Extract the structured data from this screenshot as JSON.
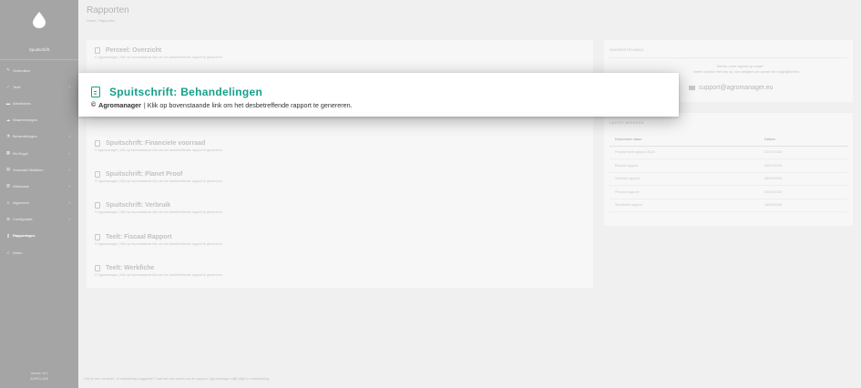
{
  "sidebar": {
    "app_name": "Spuitschrift",
    "items": [
      {
        "icon": "pencil-icon",
        "glyph": "✎",
        "label": "Verbruiken",
        "chevron": false,
        "active": false
      },
      {
        "icon": "chart-icon",
        "glyph": "⁄",
        "label": "Teelt",
        "chevron": true,
        "active": false
      },
      {
        "icon": "truck-icon",
        "glyph": "▬",
        "label": "Werkfiches",
        "chevron": false,
        "active": false
      },
      {
        "icon": "cloud-icon",
        "glyph": "☁",
        "label": "Waarnemingen",
        "chevron": false,
        "active": false
      },
      {
        "icon": "flask-icon",
        "glyph": "⚗",
        "label": "Behandelingen",
        "chevron": true,
        "active": false
      },
      {
        "icon": "box-icon",
        "glyph": "▦",
        "label": "Re-Engel",
        "chevron": true,
        "active": false
      },
      {
        "icon": "calendar-icon",
        "glyph": "▤",
        "label": "Voorraad Middelen",
        "chevron": true,
        "active": false
      },
      {
        "icon": "building-icon",
        "glyph": "▥",
        "label": "Werkbank",
        "chevron": true,
        "active": false
      },
      {
        "icon": "list-icon",
        "glyph": "≡",
        "label": "Algemeen",
        "chevron": true,
        "active": false
      },
      {
        "icon": "gear-icon",
        "glyph": "⚙",
        "label": "Configuratie",
        "chevron": true,
        "active": false
      },
      {
        "icon": "document-icon",
        "glyph": "▯",
        "label": "Rapportages",
        "chevron": false,
        "active": true
      },
      {
        "icon": "share-icon",
        "glyph": "<",
        "label": "Delen",
        "chevron": false,
        "active": false
      }
    ],
    "version_line1": "Versie: 8.0",
    "version_line2": "AGRO-245"
  },
  "header": {
    "title": "Rapporten",
    "breadcrumb_home": "Home",
    "breadcrumb_sep": "/",
    "breadcrumb_current": "Rapporten"
  },
  "reports": [
    {
      "title": "Perceel: Overzicht",
      "subtitle": "© Agromanager | Klik op bovenstaande link om het desbetreffende rapport te genereren."
    },
    {
      "title": "Spuitschrift: Behandelingen",
      "subtitle": "© Agromanager | Klik op bovenstaande link om het desbetreffende rapport te genereren."
    },
    {
      "title": "Spuitschrift: Financiele voorraad",
      "subtitle": "© Agromanager | Klik op bovenstaande link om het desbetreffende rapport te genereren."
    },
    {
      "title": "Spuitschrift: Planet Proof",
      "subtitle": "© Agromanager | Klik op bovenstaande link om het desbetreffende rapport te genereren."
    },
    {
      "title": "Spuitschrift: Verbruik",
      "subtitle": "© Agromanager | Klik op bovenstaande link om het desbetreffende rapport te genereren."
    },
    {
      "title": "Teelt: Fiscaal Rapport",
      "subtitle": "© Agromanager | Klik op bovenstaande link om het desbetreffende rapport te genereren."
    },
    {
      "title": "Teelt: Werkfiche",
      "subtitle": "© Agromanager | Klik op bovenstaande link om het desbetreffende rapport te genereren."
    }
  ],
  "focus": {
    "title": "Spuitschrift: Behandelingen",
    "copyright": "©",
    "brand": "Agromanager",
    "text": "| Klik op bovenstaande link om het desbetreffende rapport te genereren."
  },
  "support": {
    "heading": "ONDERSTEUNING",
    "question": "Wenst u een rapport op maat?",
    "text": "Neem contact met ons op, dan bekijken we samen de mogelijkheden.",
    "email": "support@agromanager.eu"
  },
  "recent": {
    "heading": "LAATST BEKEKEN",
    "col_document": "Document naam",
    "col_date": "Datum",
    "rows": [
      {
        "name": "Perceel teelt rapport 2025",
        "date": "21/07/2025"
      },
      {
        "name": "Recent rapport",
        "date": "03/07/2025"
      },
      {
        "name": "Verbruik rapport",
        "date": "09/06/2025"
      },
      {
        "name": "Perceel rapport",
        "date": "02/06/2025"
      },
      {
        "name": "Werkfiche rapport",
        "date": "18/05/2025"
      }
    ]
  },
  "footer": {
    "text": "Heb je een verbeter- of ontdekking suggestie? Laat het ons weten via de support. Agromanager blijft altijd in ontwikkeling."
  }
}
